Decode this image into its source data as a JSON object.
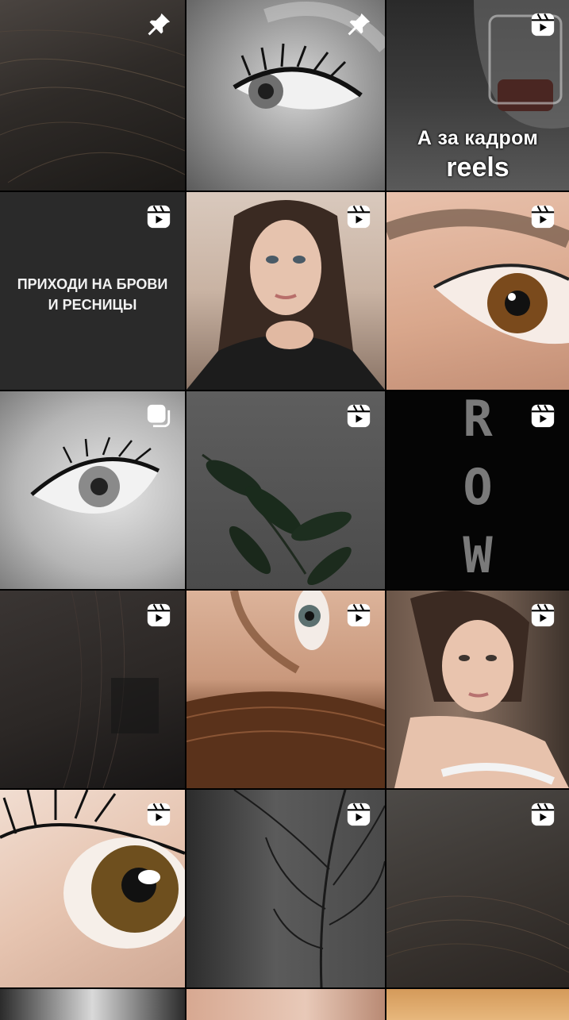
{
  "icons": {
    "pin": "pin-icon",
    "reel": "reels-icon",
    "carousel": "carousel-icon"
  },
  "tiles": [
    {
      "badge": "pin"
    },
    {
      "badge": "pin"
    },
    {
      "badge": "reel",
      "overlay_line1": "А за кадром",
      "overlay_line2": "reels"
    },
    {
      "badge": "reel",
      "caption": "ПРИХОДИ НА БРОВИ\nИ РЕСНИЦЫ"
    },
    {
      "badge": "reel"
    },
    {
      "badge": "reel"
    },
    {
      "badge": "carousel"
    },
    {
      "badge": "reel"
    },
    {
      "badge": "reel",
      "letters": [
        "R",
        "O",
        "W"
      ]
    },
    {
      "badge": "reel"
    },
    {
      "badge": "reel"
    },
    {
      "badge": "reel"
    },
    {
      "badge": "reel"
    },
    {
      "badge": "reel"
    },
    {
      "badge": "reel"
    },
    {},
    {},
    {}
  ]
}
